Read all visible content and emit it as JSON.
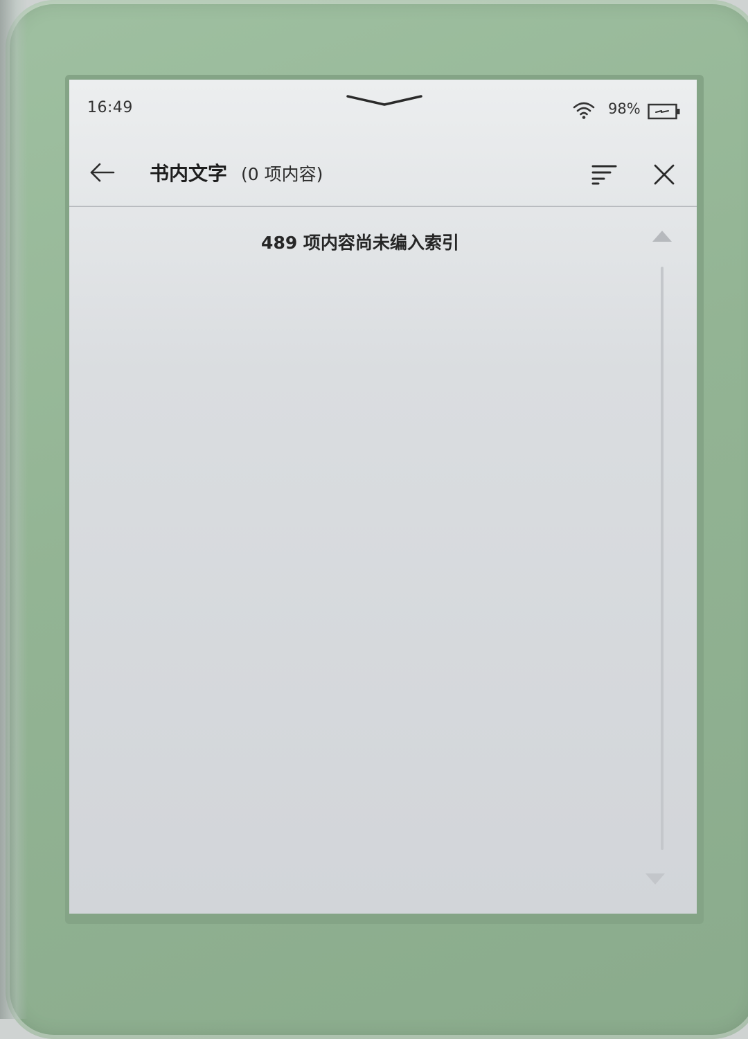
{
  "status_bar": {
    "time": "16:49",
    "battery_percent": "98%",
    "icons": [
      "wifi-icon",
      "battery-charging-icon",
      "pull-down-handle-icon"
    ]
  },
  "toolbar": {
    "title": "书内文字",
    "subtitle": "(0 项内容)",
    "icons": [
      "back-arrow-icon",
      "sort-icon",
      "close-icon"
    ]
  },
  "content": {
    "message": "489 项内容尚未编入索引"
  },
  "colors": {
    "device_frame": "#93b494",
    "screen_background": "#d8dbde",
    "text": "#262626"
  }
}
